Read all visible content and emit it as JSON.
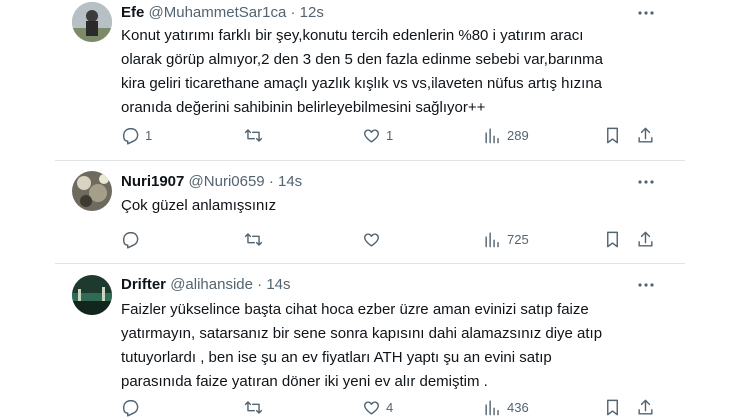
{
  "tweets": [
    {
      "name": "Efe",
      "handle": "@MuhammetSar1ca",
      "separator": "·",
      "time": "12s",
      "lines": [
        "Konut yatırımı farklı bir şey,konutu tercih edenlerin %80 i yatırım aracı",
        "olarak görüp almıyor,2 den 3 den 5 den fazla edinme sebebi var,barınma",
        "kira geliri ticarethane amaçlı yazlık kışlık vs vs,ilaveten nüfus artış hızına",
        "oranıda değerini sahibinin belirleyebilmesini sağlıyor++"
      ],
      "replies": "1",
      "retweets": "",
      "likes": "1",
      "views": "289"
    },
    {
      "name": "Nuri1907",
      "handle": "@Nuri0659",
      "separator": "·",
      "time": "14s",
      "lines": [
        "Çok güzel anlamışsınız"
      ],
      "replies": "",
      "retweets": "",
      "likes": "",
      "views": "725"
    },
    {
      "name": "Drifter",
      "handle": "@alihanside",
      "separator": "·",
      "time": "14s",
      "lines": [
        "Faizler yükselince başta cihat hoca ezber üzre aman evinizi satıp faize",
        "yatırmayın, satarsanız bir sene sonra kapısını dahi alamazsınız diye atıp",
        "tutuyorlardı , ben ise şu an ev fiyatları ATH yaptı şu an  evini satıp",
        "parasınıda faize yatıran döner iki  yeni ev alır demiştim ."
      ],
      "replies": "",
      "retweets": "",
      "likes": "4",
      "views": "436"
    }
  ],
  "icons": {
    "reply": "reply-icon",
    "retweet": "retweet-icon",
    "like": "heart-icon",
    "views": "views-icon",
    "bookmark": "bookmark-icon",
    "share": "share-icon",
    "more": "more-icon"
  },
  "colors": {
    "text": "#0f1419",
    "secondary": "#536471",
    "divider": "#dfe3e7"
  }
}
